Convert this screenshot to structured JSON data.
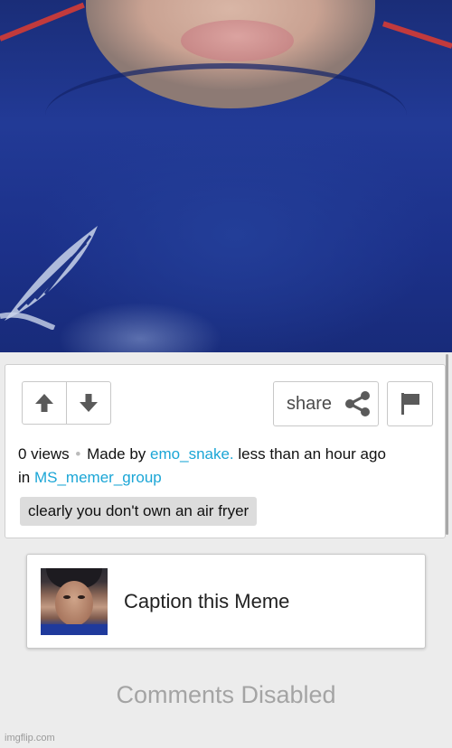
{
  "meme": {
    "image_alt": "meme image",
    "actions": {
      "upvote_icon": "arrow-up-icon",
      "downvote_icon": "arrow-down-icon",
      "share_label": "share",
      "share_icon": "share-icon",
      "flag_icon": "flag-icon"
    },
    "meta": {
      "views": "0 views",
      "separator": "•",
      "made_by_prefix": "Made by",
      "author": "emo_snake.",
      "time": "less than an hour ago",
      "in_prefix": "in",
      "group": "MS_memer_group"
    },
    "title_tag": "clearly you don't own an air fryer"
  },
  "caption_card": {
    "label": "Caption this Meme"
  },
  "comments_status": "Comments Disabled",
  "watermark": "imgflip.com",
  "colors": {
    "link": "#1ba6d6",
    "icon": "#5a5a5a",
    "shirt_blue": "#223a96"
  }
}
